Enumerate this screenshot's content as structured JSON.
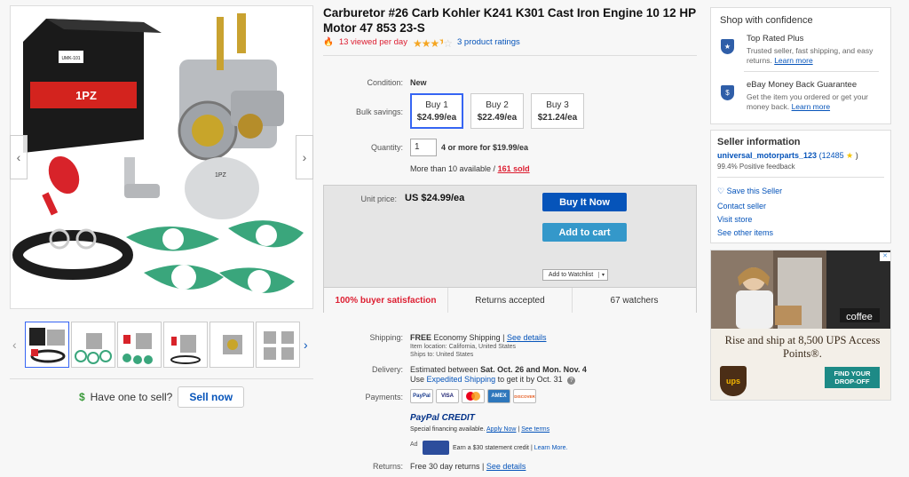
{
  "product": {
    "title": "Carburetor #26 Carb Kohler K241 K301 Cast Iron Engine 10 12 HP Motor 47 853 23-S",
    "viewed": "13 viewed per day",
    "ratings": "3 product ratings",
    "rating_stars": 3.5
  },
  "gallery": {
    "box_brand": "1PZ",
    "box_model": "UMK-101",
    "part_label": "1PZ",
    "thumb_count": 6
  },
  "sell": {
    "prompt": "Have one to sell?",
    "button": "Sell now"
  },
  "details": {
    "condition_label": "Condition:",
    "condition_value": "New",
    "bulk_label": "Bulk savings:",
    "bulk": [
      {
        "name": "Buy 1",
        "price": "$24.99/ea"
      },
      {
        "name": "Buy 2",
        "price": "$22.49/ea"
      },
      {
        "name": "Buy 3",
        "price": "$21.24/ea"
      }
    ],
    "quantity_label": "Quantity:",
    "quantity_value": "1",
    "quantity_offer": "4 or more for $19.99/ea",
    "availability": "More than 10 available /",
    "sold": "161 sold"
  },
  "buybox": {
    "unit_price_label": "Unit price:",
    "unit_price": "US $24.99/ea",
    "buy_now": "Buy It Now",
    "add_cart": "Add to cart",
    "watchlist": "Add to Watchlist",
    "satisfaction": "100% buyer satisfaction",
    "returns": "Returns accepted",
    "watchers": "67 watchers"
  },
  "shipping": {
    "label": "Shipping:",
    "free": "FREE",
    "method": "Economy Shipping |",
    "see_details": "See details",
    "location": "Item location:  California, United States",
    "ships_to": "Ships to:  United States",
    "delivery_label": "Delivery:",
    "delivery_pre": "Estimated between",
    "delivery_dates": "Sat. Oct. 26 and Mon. Nov. 4",
    "expedited_pre": "Use",
    "expedited_link": "Expedited Shipping",
    "expedited_post": "to get it by Oct. 31"
  },
  "payments": {
    "label": "Payments:",
    "cards": [
      "PayPal",
      "VISA",
      "MC",
      "AMEX",
      "DISCOVER"
    ],
    "credit_brand": "PayPal CREDIT",
    "credit_text": "Special financing available.",
    "apply": "Apply Now",
    "terms": "See terms",
    "ad_label": "Ad",
    "ad_text": "Earn a $30 statement credit |",
    "learn_more": "Learn More."
  },
  "returns": {
    "label": "Returns:",
    "text": "Free 30 day returns |",
    "see_details": "See details"
  },
  "confidence": {
    "title": "Shop with confidence",
    "items": [
      {
        "title": "Top Rated Plus",
        "desc": "Trusted seller, fast shipping, and easy returns.",
        "link": "Learn more"
      },
      {
        "title": "eBay Money Back Guarantee",
        "desc": "Get the item you ordered or get your money back.",
        "link": "Learn more"
      }
    ]
  },
  "seller": {
    "title": "Seller information",
    "name": "universal_motorparts_123",
    "score": "(12485",
    "score_end": ")",
    "feedback": "99.4% Positive feedback",
    "save": "Save this Seller",
    "contact": "Contact seller",
    "store": "Visit store",
    "other": "See other items"
  },
  "ad": {
    "headline": "Rise and ship at 8,500 UPS Access Points®.",
    "cta": "FIND YOUR DROP-OFF",
    "logo": "ups",
    "sign": "coffee"
  },
  "colors": {
    "accent": "#3665f3",
    "buy_now": "#0654ba",
    "add_cart": "#3498ca",
    "hot": "#dd1e31",
    "ups_green": "#1d8a86"
  }
}
